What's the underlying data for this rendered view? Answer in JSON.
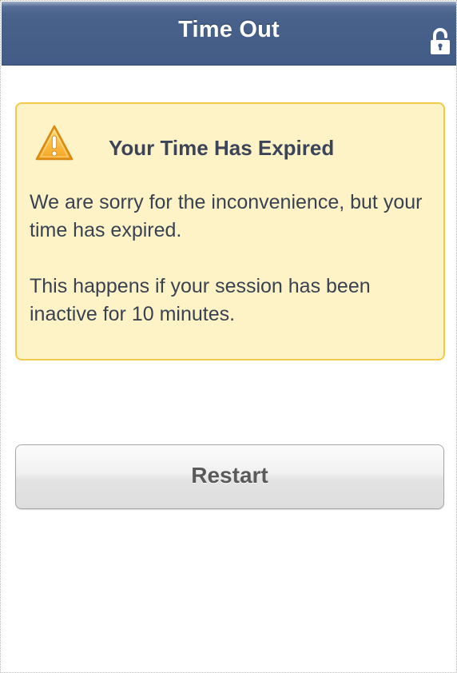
{
  "header": {
    "title": "Time Out",
    "icon": "lock-icon",
    "color": "#435c87"
  },
  "alert": {
    "icon": "warning-icon",
    "title": "Your Time Has Expired",
    "paragraph_1": "We are sorry for the inconvenience, but your time has expired.",
    "paragraph_2": "This happens if your session has been inactive for 10 minutes.",
    "background": "#fdf3c7",
    "border": "#f2c94b"
  },
  "actions": {
    "restart_label": "Restart"
  }
}
